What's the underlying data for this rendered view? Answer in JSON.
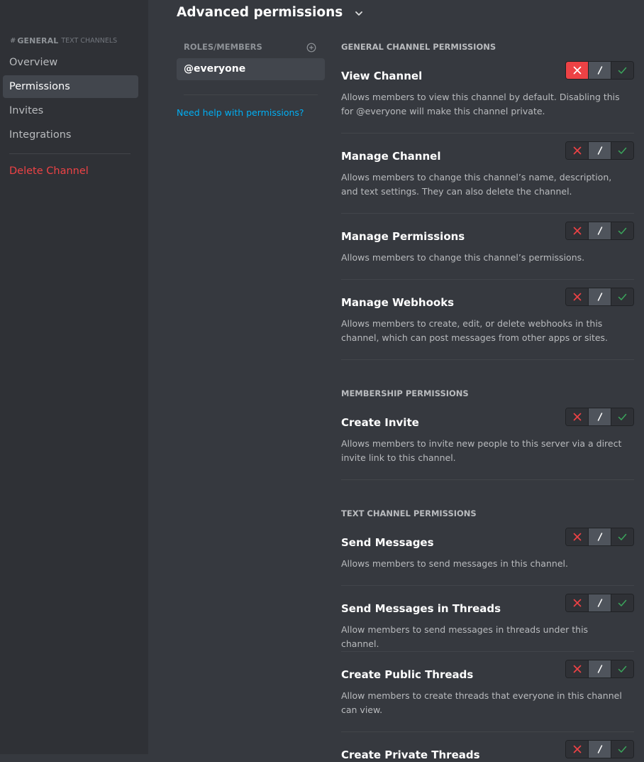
{
  "sidebar": {
    "channel_name": "GENERAL",
    "channel_category": "TEXT CHANNELS",
    "items": [
      {
        "label": "Overview"
      },
      {
        "label": "Permissions"
      },
      {
        "label": "Invites"
      },
      {
        "label": "Integrations"
      }
    ],
    "delete_label": "Delete Channel"
  },
  "header": {
    "title": "Advanced permissions"
  },
  "roles": {
    "heading": "ROLES/MEMBERS",
    "items": [
      {
        "label": "@everyone"
      }
    ],
    "help_link": "Need help with permissions?"
  },
  "sections": [
    {
      "title": "GENERAL CHANNEL PERMISSIONS",
      "permissions": [
        {
          "name": "View Channel",
          "description": "Allows members to view this channel by default. Disabling this for @everyone will make this channel private.",
          "state": "deny"
        },
        {
          "name": "Manage Channel",
          "description": "Allows members to change this channel’s name, description, and text settings. They can also delete the channel.",
          "state": "neutral"
        },
        {
          "name": "Manage Permissions",
          "description": "Allows members to change this channel’s permissions.",
          "state": "neutral"
        },
        {
          "name": "Manage Webhooks",
          "description": "Allows members to create, edit, or delete webhooks in this channel, which can post messages from other apps or sites.",
          "state": "neutral"
        }
      ]
    },
    {
      "title": "MEMBERSHIP PERMISSIONS",
      "permissions": [
        {
          "name": "Create Invite",
          "description": "Allows members to invite new people to this server via a direct invite link to this channel.",
          "state": "neutral"
        }
      ]
    },
    {
      "title": "TEXT CHANNEL PERMISSIONS",
      "permissions": [
        {
          "name": "Send Messages",
          "description": "Allows members to send messages in this channel.",
          "state": "neutral"
        },
        {
          "name": "Send Messages in Threads",
          "description": "Allow members to send messages in threads under this channel.",
          "state": "neutral"
        },
        {
          "name": "Create Public Threads",
          "description": "Allow members to create threads that everyone in this channel can view.",
          "state": "neutral"
        },
        {
          "name": "Create Private Threads",
          "description": "",
          "state": "neutral"
        }
      ]
    }
  ],
  "colors": {
    "deny": "#ed4245",
    "allow": "#3ba55c",
    "link": "#00aff4",
    "sidebar_bg": "#2f3136",
    "content_bg": "#36393f"
  }
}
